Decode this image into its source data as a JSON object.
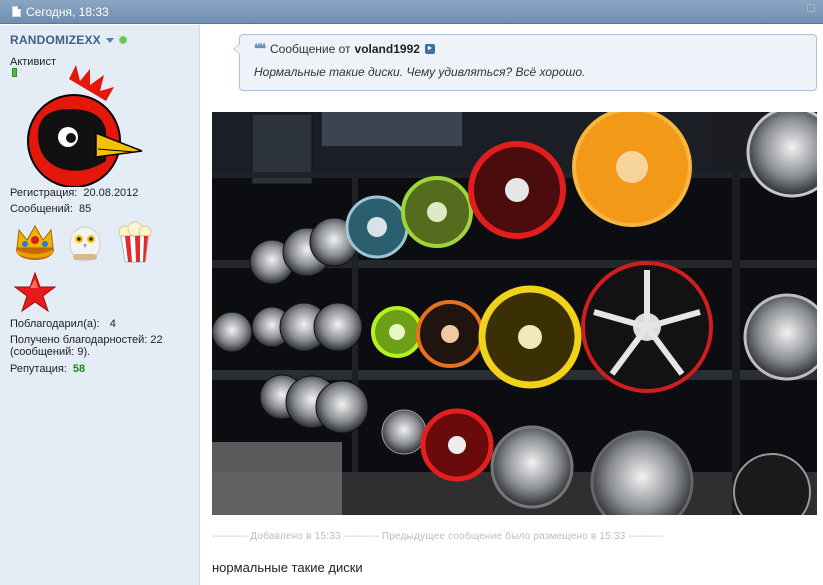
{
  "post_header": {
    "date": "Сегодня, 18:33"
  },
  "user": {
    "username": "RANDOMIZEXX",
    "title": "Активист",
    "registration_label": "Регистрация:",
    "registration_value": "20.08.2012",
    "messages_label": "Сообщений:",
    "messages_value": "85",
    "thanked_label": "Поблагодарил(а):",
    "thanked_value": "4",
    "thanks_received_line1": "Получено благодарностей: 22",
    "thanks_received_line2": "(сообщений: 9).",
    "reputation_label": "Репутация:",
    "reputation_value": "58",
    "awards": [
      "crown-award-icon",
      "owl-award-icon",
      "popcorn-award-icon"
    ],
    "extra_award": "red-star-award-icon"
  },
  "quote": {
    "prefix": "Сообщение от",
    "author": "voland1992",
    "text": "Нормальные такие диски. Чему удивляться? Всё хорошо."
  },
  "photo": {
    "description_icon": "wheel-rims-photo"
  },
  "merge_notice": "---------- Добавлено в 15:33 ---------- Предыдущее сообщение было размещено в 15:33 ----------",
  "post_text": "нормальные такие диски",
  "colors": {
    "header_bg": "#7a98b8",
    "sidebar_bg": "#e4ecf5",
    "username": "#3d5f8a",
    "reputation": "#1c8a1c",
    "quote_border": "#a9c1d9"
  }
}
